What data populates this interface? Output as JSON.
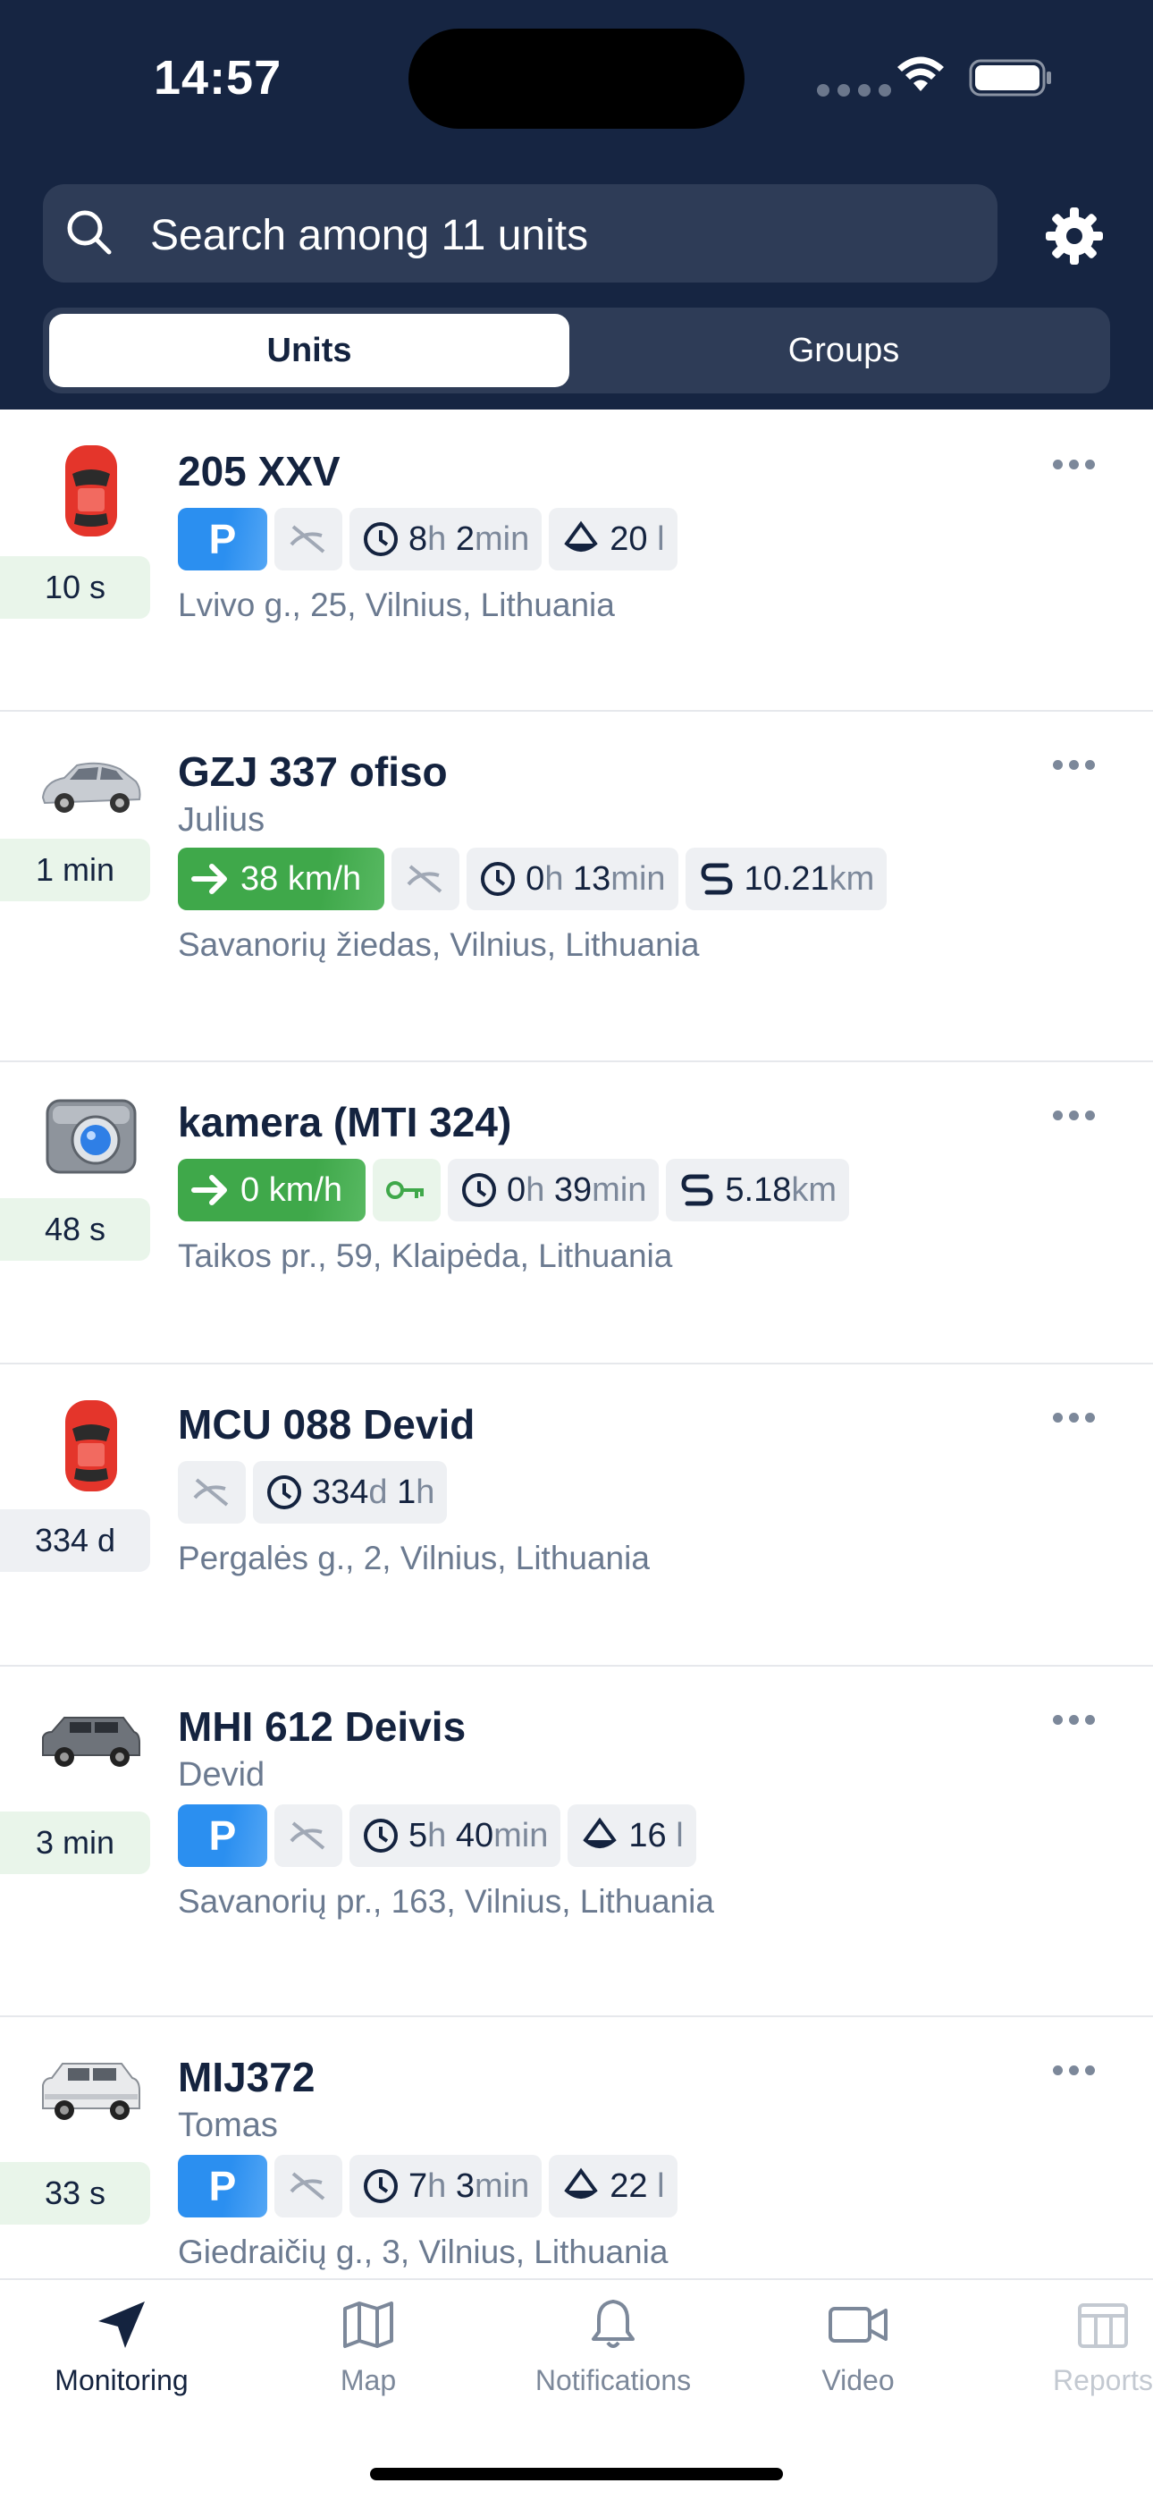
{
  "status_bar": {
    "time": "14:57"
  },
  "search": {
    "placeholder": "Search among 11 units"
  },
  "segment": {
    "active": "Units",
    "inactive": "Groups"
  },
  "units": [
    {
      "name": "205 XXV",
      "driver": "",
      "last_update": "10 s",
      "icon": "red-car-icon",
      "state": "parked",
      "duration_h": "8",
      "duration_h_unit": "h",
      "duration_m": "2",
      "duration_m_unit": "min",
      "fuel": "20",
      "fuel_unit": "l",
      "address": "Lvivo g., 25, Vilnius, Lithuania"
    },
    {
      "name": "GZJ 337 ofiso",
      "driver": "Julius",
      "last_update": "1 min",
      "icon": "silver-car-icon",
      "state": "moving",
      "speed": "38 km/h",
      "duration_h": "0",
      "duration_h_unit": "h",
      "duration_m": "13",
      "duration_m_unit": "min",
      "mileage": "10.21",
      "mileage_unit": "km",
      "address": "Savanorių žiedas, Vilnius, Lithuania"
    },
    {
      "name": "kamera (MTI 324)",
      "driver": "",
      "last_update": "48 s",
      "icon": "camera-icon",
      "state": "moving",
      "speed": "0 km/h",
      "duration_h": "0",
      "duration_h_unit": "h",
      "duration_m": "39",
      "duration_m_unit": "min",
      "mileage": "5.18",
      "mileage_unit": "km",
      "address": "Taikos pr., 59, Klaipėda, Lithuania"
    },
    {
      "name": "MCU 088 Devid",
      "driver": "",
      "last_update": "334 d",
      "icon": "red-car-icon",
      "state": "unknown",
      "duration_d": "334",
      "duration_d_unit": "d",
      "duration_h": "1",
      "duration_h_unit": "h",
      "address": "Pergalės g., 2, Vilnius, Lithuania"
    },
    {
      "name": "MHI 612 Deivis",
      "driver": "Devid",
      "last_update": "3 min",
      "icon": "grey-suv-icon",
      "state": "parked",
      "duration_h": "5",
      "duration_h_unit": "h",
      "duration_m": "40",
      "duration_m_unit": "min",
      "fuel": "16",
      "fuel_unit": "l",
      "address": "Savanorių pr., 163, Vilnius, Lithuania"
    },
    {
      "name": "MIJ372",
      "driver": "Tomas",
      "last_update": "33 s",
      "icon": "white-suv-icon",
      "state": "parked",
      "duration_h": "7",
      "duration_h_unit": "h",
      "duration_m": "3",
      "duration_m_unit": "min",
      "fuel": "22",
      "fuel_unit": "l",
      "address": "Giedraičių g., 3, Vilnius, Lithuania"
    }
  ],
  "chip_labels": {
    "parking": "P"
  },
  "tabbar": {
    "monitoring": "Monitoring",
    "map": "Map",
    "notifications": "Notifications",
    "video": "Video",
    "reports": "Reports"
  },
  "colors": {
    "header_bg": "#162542",
    "parking_blue": "#2b8ff0",
    "moving_green": "#3fa84a",
    "text_dark": "#14233f",
    "text_muted": "#6b7a90"
  }
}
